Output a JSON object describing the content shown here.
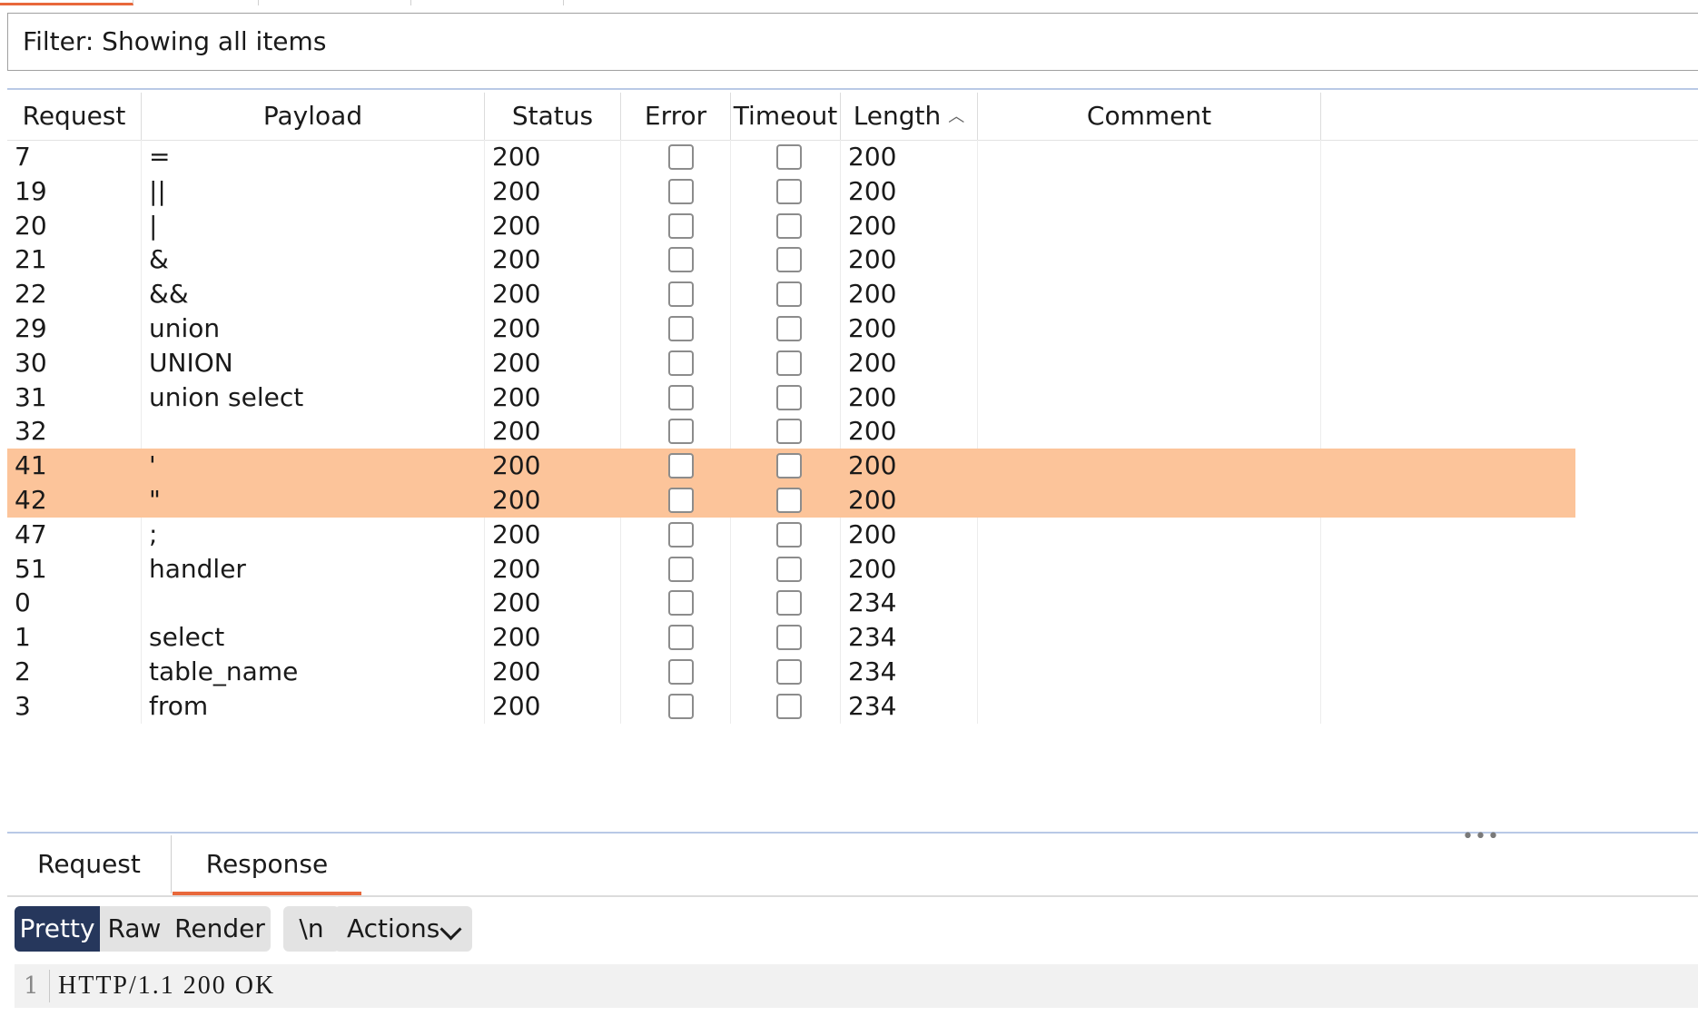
{
  "filter": {
    "text": "Filter: Showing all items"
  },
  "columns": [
    {
      "key": "request",
      "label": "Request"
    },
    {
      "key": "payload",
      "label": "Payload"
    },
    {
      "key": "status",
      "label": "Status"
    },
    {
      "key": "error",
      "label": "Error"
    },
    {
      "key": "timeout",
      "label": "Timeout"
    },
    {
      "key": "length",
      "label": "Length",
      "sort": "ascending"
    },
    {
      "key": "comment",
      "label": "Comment"
    }
  ],
  "rows": [
    {
      "request": "7",
      "payload": "=",
      "status": "200",
      "error": false,
      "timeout": false,
      "length": "200",
      "comment": "",
      "highlight": false
    },
    {
      "request": "19",
      "payload": "||",
      "status": "200",
      "error": false,
      "timeout": false,
      "length": "200",
      "comment": "",
      "highlight": false
    },
    {
      "request": "20",
      "payload": "|",
      "status": "200",
      "error": false,
      "timeout": false,
      "length": "200",
      "comment": "",
      "highlight": false
    },
    {
      "request": "21",
      "payload": "&",
      "status": "200",
      "error": false,
      "timeout": false,
      "length": "200",
      "comment": "",
      "highlight": false
    },
    {
      "request": "22",
      "payload": "&&",
      "status": "200",
      "error": false,
      "timeout": false,
      "length": "200",
      "comment": "",
      "highlight": false
    },
    {
      "request": "29",
      "payload": "union",
      "status": "200",
      "error": false,
      "timeout": false,
      "length": "200",
      "comment": "",
      "highlight": false
    },
    {
      "request": "30",
      "payload": "UNION",
      "status": "200",
      "error": false,
      "timeout": false,
      "length": "200",
      "comment": "",
      "highlight": false
    },
    {
      "request": "31",
      "payload": "union select",
      "status": "200",
      "error": false,
      "timeout": false,
      "length": "200",
      "comment": "",
      "highlight": false
    },
    {
      "request": "32",
      "payload": "",
      "status": "200",
      "error": false,
      "timeout": false,
      "length": "200",
      "comment": "",
      "highlight": false
    },
    {
      "request": "41",
      "payload": "'",
      "status": "200",
      "error": false,
      "timeout": false,
      "length": "200",
      "comment": "",
      "highlight": true
    },
    {
      "request": "42",
      "payload": "\"",
      "status": "200",
      "error": false,
      "timeout": false,
      "length": "200",
      "comment": "",
      "highlight": true
    },
    {
      "request": "47",
      "payload": ";",
      "status": "200",
      "error": false,
      "timeout": false,
      "length": "200",
      "comment": "",
      "highlight": false
    },
    {
      "request": "51",
      "payload": "handler",
      "status": "200",
      "error": false,
      "timeout": false,
      "length": "200",
      "comment": "",
      "highlight": false
    },
    {
      "request": "0",
      "payload": "",
      "status": "200",
      "error": false,
      "timeout": false,
      "length": "234",
      "comment": "",
      "highlight": false
    },
    {
      "request": "1",
      "payload": "select",
      "status": "200",
      "error": false,
      "timeout": false,
      "length": "234",
      "comment": "",
      "highlight": false
    },
    {
      "request": "2",
      "payload": "table_name",
      "status": "200",
      "error": false,
      "timeout": false,
      "length": "234",
      "comment": "",
      "highlight": false
    },
    {
      "request": "3",
      "payload": "from",
      "status": "200",
      "error": false,
      "timeout": false,
      "length": "234",
      "comment": "",
      "highlight": false
    }
  ],
  "highlight_color": "#fcc49a",
  "accent_color": "#e8683b",
  "viewer": {
    "tabs": [
      {
        "label": "Request",
        "active": false
      },
      {
        "label": "Response",
        "active": true
      }
    ],
    "toolbar": {
      "pretty": "Pretty",
      "raw": "Raw",
      "render": "Render",
      "newline": "\\n",
      "actions": "Actions"
    },
    "lines": [
      {
        "number": "1",
        "text": "HTTP/1.1 200 OK"
      }
    ]
  }
}
